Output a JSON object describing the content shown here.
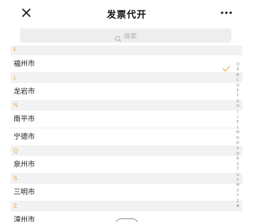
{
  "nav": {
    "title": "发票代开",
    "close_icon": "close-icon",
    "more_icon": "more-icon"
  },
  "search": {
    "placeholder": "搜索"
  },
  "groups": [
    {
      "letter": "F",
      "cities": [
        "福州市"
      ]
    },
    {
      "letter": "L",
      "cities": [
        "龙岩市"
      ]
    },
    {
      "letter": "N",
      "cities": [
        "南平市",
        "宁德市"
      ]
    },
    {
      "letter": "Q",
      "cities": [
        "泉州市"
      ]
    },
    {
      "letter": "S",
      "cities": [
        "三明市"
      ]
    },
    {
      "letter": "Z",
      "cities": [
        "漳州市"
      ]
    }
  ],
  "selected_city": "福州市",
  "index_letters": [
    "Q",
    "A",
    "B",
    "C",
    "D",
    "E",
    "F",
    "G",
    "H",
    "I",
    "J",
    "K",
    "L",
    "M",
    "N",
    "O",
    "P",
    "Q",
    "R",
    "S",
    "T",
    "U",
    "V",
    "W",
    "X",
    "Y",
    "Z",
    "#"
  ],
  "colors": {
    "accent": "#f0a24a",
    "index": "#8a8a8a"
  }
}
